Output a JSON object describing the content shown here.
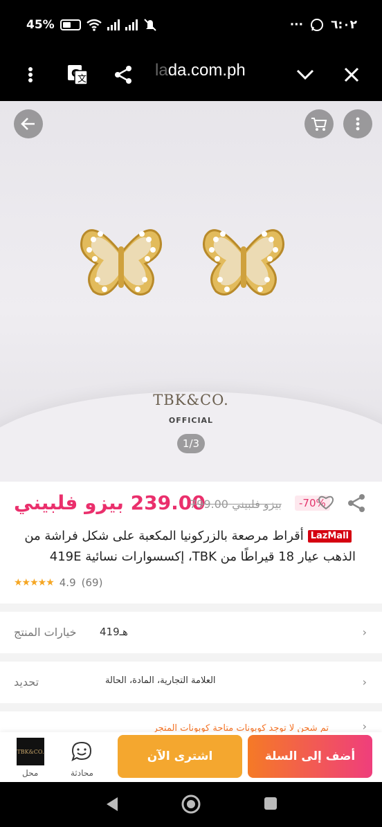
{
  "status_bar": {
    "battery_percent": "45%",
    "time": "٦:٠٢"
  },
  "browser": {
    "url_visible": "da.com.ph",
    "url_faded": "la"
  },
  "gallery": {
    "brand_logo": "TBK&CO.",
    "brand_sub": "OFFICIAL",
    "pager": "1/3",
    "image_desc": "gold butterfly earrings"
  },
  "product": {
    "price": "239.00 بيزو فلبيني",
    "old_price": "799.00 بيزو فلبيني",
    "discount": "-70%",
    "badge": "LazMall",
    "title": "أقراط مرصعة بالزركونيا المكعبة على شكل فراشة من الذهب عيار 18 قيراطًا من TBK، إكسسوارات نسائية 419E",
    "rating": "4.9",
    "review_count": "(69)"
  },
  "options": {
    "variant_label": "خيارات المنتج",
    "variant_value": "419هـ",
    "spec_label": "تحديد",
    "spec_value": "العلامة التجارية، المادة، الحالة",
    "promo_text": "تم شحن لا توجد كوبونات متاحة كوبونات المتجر"
  },
  "actions": {
    "store_logo": "TBK&CO.",
    "store_label": "محل",
    "chat_label": "محادثة",
    "buy_now": "اشترى الآن",
    "add_to_cart": "أضف إلى السلة"
  },
  "colors": {
    "accent": "#ea2f6c",
    "buy": "#f4a72f",
    "cart_start": "#f57a26",
    "cart_end": "#ef3e7c"
  }
}
